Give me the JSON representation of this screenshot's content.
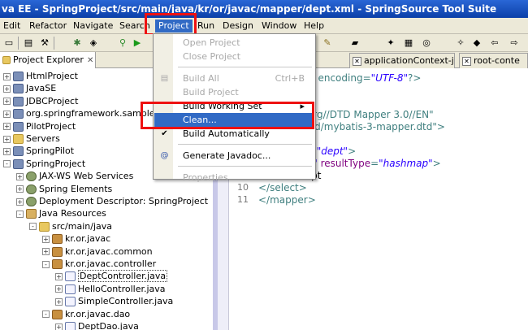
{
  "window": {
    "title": "va EE - SpringProject/src/main/java/kr/or/javac/mapper/dept.xml - SpringSource Tool Suite"
  },
  "menubar": {
    "items": [
      "Edit",
      "Refactor",
      "Navigate",
      "Search",
      "Project",
      "Run",
      "Design",
      "Window",
      "Help"
    ],
    "active": "Project"
  },
  "toolbar": {
    "icons": [
      "save-icon",
      "print-icon",
      "build-icon",
      "debug-icon",
      "run-icon",
      "new-icon",
      "search-icon",
      "nav-back-icon"
    ]
  },
  "explorer": {
    "tab_label": "Project Explorer",
    "tree": [
      {
        "label": "HtmlProject",
        "depth": 0,
        "toggle": "+",
        "icon": "project-icon"
      },
      {
        "label": "JavaSE",
        "depth": 0,
        "toggle": "+",
        "icon": "project-icon"
      },
      {
        "label": "JDBCProject",
        "depth": 0,
        "toggle": "+",
        "icon": "project-icon"
      },
      {
        "label": "org.springframework.samples",
        "depth": 0,
        "toggle": "+",
        "icon": "project-icon"
      },
      {
        "label": "PilotProject",
        "depth": 0,
        "toggle": "+",
        "icon": "project-icon"
      },
      {
        "label": "Servers",
        "depth": 0,
        "toggle": "+",
        "icon": "folder-icon"
      },
      {
        "label": "SpringPilot",
        "depth": 0,
        "toggle": "+",
        "icon": "project-icon"
      },
      {
        "label": "SpringProject",
        "depth": 0,
        "toggle": "-",
        "icon": "project-icon"
      },
      {
        "label": "JAX-WS Web Services",
        "depth": 1,
        "toggle": "+",
        "icon": "gear-icon"
      },
      {
        "label": "Spring Elements",
        "depth": 1,
        "toggle": "+",
        "icon": "gear-icon"
      },
      {
        "label": "Deployment Descriptor: SpringProject",
        "depth": 1,
        "toggle": "+",
        "icon": "gear-icon"
      },
      {
        "label": "Java Resources",
        "depth": 1,
        "toggle": "-",
        "icon": "library-icon"
      },
      {
        "label": "src/main/java",
        "depth": 2,
        "toggle": "-",
        "icon": "folder-icon"
      },
      {
        "label": "kr.or.javac",
        "depth": 3,
        "toggle": "+",
        "icon": "package-icon"
      },
      {
        "label": "kr.or.javac.common",
        "depth": 3,
        "toggle": "+",
        "icon": "package-icon"
      },
      {
        "label": "kr.or.javac.controller",
        "depth": 3,
        "toggle": "-",
        "icon": "package-icon"
      },
      {
        "label": "DeptController.java",
        "depth": 4,
        "toggle": "+",
        "icon": "java-file-icon",
        "selected": true
      },
      {
        "label": "HelloController.java",
        "depth": 4,
        "toggle": "+",
        "icon": "java-file-icon"
      },
      {
        "label": "SimpleController.java",
        "depth": 4,
        "toggle": "+",
        "icon": "java-file-icon"
      },
      {
        "label": "kr.or.javac.dao",
        "depth": 3,
        "toggle": "-",
        "icon": "package-icon"
      },
      {
        "label": "DeptDao.java",
        "depth": 4,
        "toggle": "+",
        "icon": "java-file-icon"
      }
    ]
  },
  "editor": {
    "tabs": [
      "ext-d",
      "applicationContext-j",
      "root-conte"
    ],
    "lines": [
      {
        "num": "",
        "parts": [
          [
            "attr",
            "rsion"
          ],
          [
            "kw",
            "="
          ],
          [
            "str",
            "\"1.0\""
          ],
          [
            "kw",
            " encoding="
          ],
          [
            "str",
            "\"UTF-8\""
          ],
          [
            "kw",
            "?>"
          ]
        ]
      },
      {
        "num": "",
        "parts": []
      },
      {
        "num": "",
        "parts": [
          [
            "kw",
            "mapper"
          ]
        ]
      },
      {
        "num": "",
        "parts": [
          [
            "kw",
            "//mybatis.org//DTD Mapper 3.0//EN\""
          ]
        ]
      },
      {
        "num": "",
        "parts": [
          [
            "kw",
            "batis.org/dtd/mybatis-3-mapper.dtd\">"
          ]
        ]
      },
      {
        "num": "",
        "parts": []
      },
      {
        "num": "",
        "parts": [
          [
            "attr",
            "amespace"
          ],
          [
            "kw",
            "="
          ],
          [
            "str",
            "\"dept\""
          ],
          [
            "kw",
            ">"
          ]
        ]
      },
      {
        "num": "",
        "parts": [
          [
            "attr",
            "id"
          ],
          [
            "kw",
            "="
          ],
          [
            "str",
            "\"getList\""
          ],
          [
            "attr",
            " resultType"
          ],
          [
            "kw",
            "="
          ],
          [
            "str",
            "\"hashmap\""
          ],
          [
            "kw",
            ">"
          ]
        ]
      },
      {
        "num": "",
        "parts": [
          [
            "",
            "t * from dept"
          ]
        ]
      },
      {
        "num": "10",
        "parts": [
          [
            "kw",
            "</select>"
          ]
        ]
      },
      {
        "num": "11",
        "parts": [
          [
            "kw",
            "</mapper>"
          ]
        ]
      }
    ]
  },
  "project_menu": {
    "items": [
      {
        "label": "Open Project",
        "enabled": false
      },
      {
        "label": "Close Project",
        "enabled": false
      },
      {
        "sep": true
      },
      {
        "label": "Build All",
        "accel": "Ctrl+B",
        "enabled": false,
        "icon": "build-all-icon"
      },
      {
        "label": "Build Project",
        "enabled": false
      },
      {
        "label": "Build Working Set",
        "enabled": true,
        "submenu": true
      },
      {
        "label": "Clean...",
        "enabled": true,
        "selected": true
      },
      {
        "label": "Build Automatically",
        "enabled": true,
        "checked": true
      },
      {
        "sep": true
      },
      {
        "label": "Generate Javadoc...",
        "enabled": true,
        "icon": "javadoc-icon"
      },
      {
        "sep": true
      },
      {
        "label": "Properties",
        "enabled": false
      }
    ]
  }
}
